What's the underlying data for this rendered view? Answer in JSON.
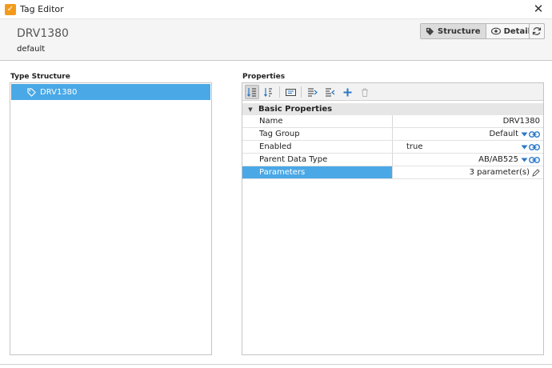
{
  "window": {
    "title": "Tag Editor",
    "app_icon_glyph": "✓",
    "close_glyph": "✕"
  },
  "header": {
    "tag_name": "DRV1380",
    "subtitle": "default",
    "view_tabs": [
      {
        "label": "Structure",
        "icon": "tag-icon",
        "active": true
      },
      {
        "label": "Details",
        "icon": "eye-icon",
        "active": false
      }
    ],
    "refresh_icon": "refresh-icon"
  },
  "type_structure": {
    "label": "Type Structure",
    "items": [
      {
        "label": "DRV1380",
        "icon": "tag-icon",
        "selected": true
      }
    ]
  },
  "properties": {
    "label": "Properties",
    "toolbar_icons": [
      "sort-category-icon",
      "sort-alpha-icon",
      "property-editor-icon",
      "expand-all-icon",
      "collapse-all-icon",
      "add-icon",
      "delete-icon"
    ],
    "group": {
      "label": "Basic Properties"
    },
    "rows": [
      {
        "name": "Name",
        "value": "DRV1380"
      },
      {
        "name": "Tag Group",
        "value": "Default"
      },
      {
        "name": "Enabled",
        "value": "true"
      },
      {
        "name": "Parent Data Type",
        "value": "AB/AB525"
      },
      {
        "name": "Parameters",
        "value": "3 parameter(s)"
      }
    ]
  },
  "colors": {
    "selection": "#4aa8e6",
    "accent_icon": "#2b78c6",
    "app_icon": "#f39a1c"
  }
}
